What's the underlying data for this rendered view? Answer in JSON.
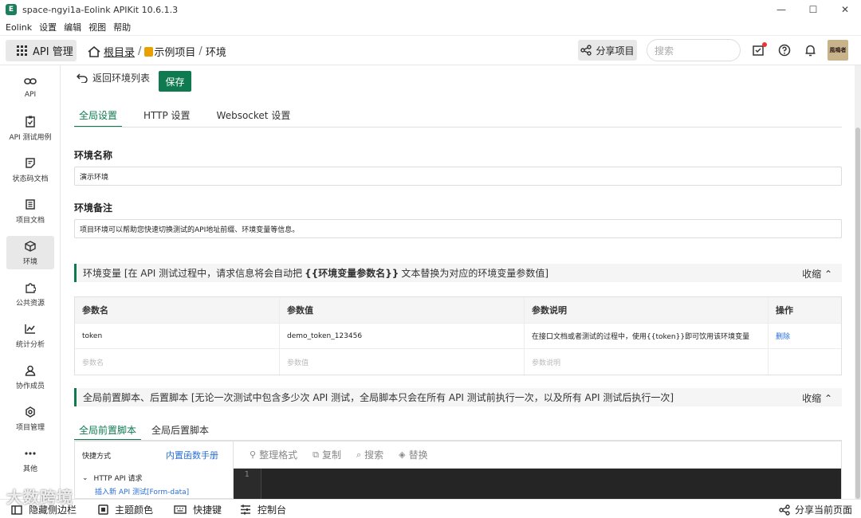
{
  "window": {
    "logo": "E",
    "title": "space-ngyi1a-Eolink APIKit 10.6.1.3",
    "minimize": "—",
    "maximize": "☐",
    "close": "✕"
  },
  "menubar": [
    "Eolink",
    "设置",
    "编辑",
    "视图",
    "帮助"
  ],
  "header": {
    "api_management": "API 管理",
    "breadcrumb": {
      "root": "根目录",
      "sep1": "/",
      "project": "示例项目",
      "sep2": "/",
      "current": "环境"
    },
    "share_project": "分享项目",
    "search_placeholder": "搜索",
    "avatar_text": "風鳴者"
  },
  "sidebar": {
    "items": [
      {
        "label": "API",
        "icon": "link-icon"
      },
      {
        "label": "API 测试用例",
        "icon": "clipboard-check-icon"
      },
      {
        "label": "状态码文档",
        "icon": "note-icon"
      },
      {
        "label": "项目文档",
        "icon": "document-icon"
      },
      {
        "label": "环境",
        "icon": "cube-icon",
        "active": true
      },
      {
        "label": "公共资源",
        "icon": "puzzle-icon"
      },
      {
        "label": "统计分析",
        "icon": "chart-icon"
      },
      {
        "label": "协作成员",
        "icon": "members-icon"
      },
      {
        "label": "项目管理",
        "icon": "gear-icon"
      },
      {
        "label": "其他",
        "icon": "more-icon"
      }
    ]
  },
  "main": {
    "back_label": "返回环境列表",
    "save_label": "保存",
    "tabs": [
      "全局设置",
      "HTTP 设置",
      "Websocket 设置"
    ],
    "env_name_label": "环境名称",
    "env_name_value": "演示环境",
    "env_note_label": "环境备注",
    "env_note_value": "项目环境可以帮助您快速切换测试的API地址前缀、环境变量等信息。",
    "env_var_section": {
      "prefix": "环境变量 [在 API 测试过程中，请求信息将会自动把",
      "highlight": "{{环境变量参数名}}",
      "suffix": "文本替换为对应的环境变量参数值]",
      "collapse": "收缩"
    },
    "var_table": {
      "headers": [
        "参数名",
        "参数值",
        "参数说明",
        "操作"
      ],
      "rows": [
        {
          "name": "token",
          "value": "demo_token_123456",
          "desc": "在接口文档或者测试的过程中，使用{{token}}即可饮用该环境变量",
          "action": "删除"
        }
      ],
      "placeholders": {
        "name": "参数名",
        "value": "参数值",
        "desc": "参数说明"
      }
    },
    "script_section": {
      "text": "全局前置脚本、后置脚本 [无论一次测试中包含多少次 API 测试，全局脚本只会在所有 API 测试前执行一次，以及所有 API 测试后执行一次]",
      "collapse": "收缩"
    },
    "script_tabs": [
      "全局前置脚本",
      "全局后置脚本"
    ],
    "shortcuts": {
      "title": "快捷方式",
      "manual_link": "内置函数手册",
      "group": "HTTP API 请求",
      "item": "插入新 API 测试[Form-data]"
    },
    "editor_toolbar": [
      "整理格式",
      "复制",
      "搜索",
      "替换"
    ],
    "line_number": "1"
  },
  "statusbar": {
    "hide_sidebar": "隐藏侧边栏",
    "theme": "主题颜色",
    "shortcuts": "快捷键",
    "console": "控制台",
    "share_page": "分享当前页面",
    "watermark": "大数跨境"
  },
  "colors": {
    "primary": "#0f7a50",
    "link": "#2a6fd6"
  }
}
